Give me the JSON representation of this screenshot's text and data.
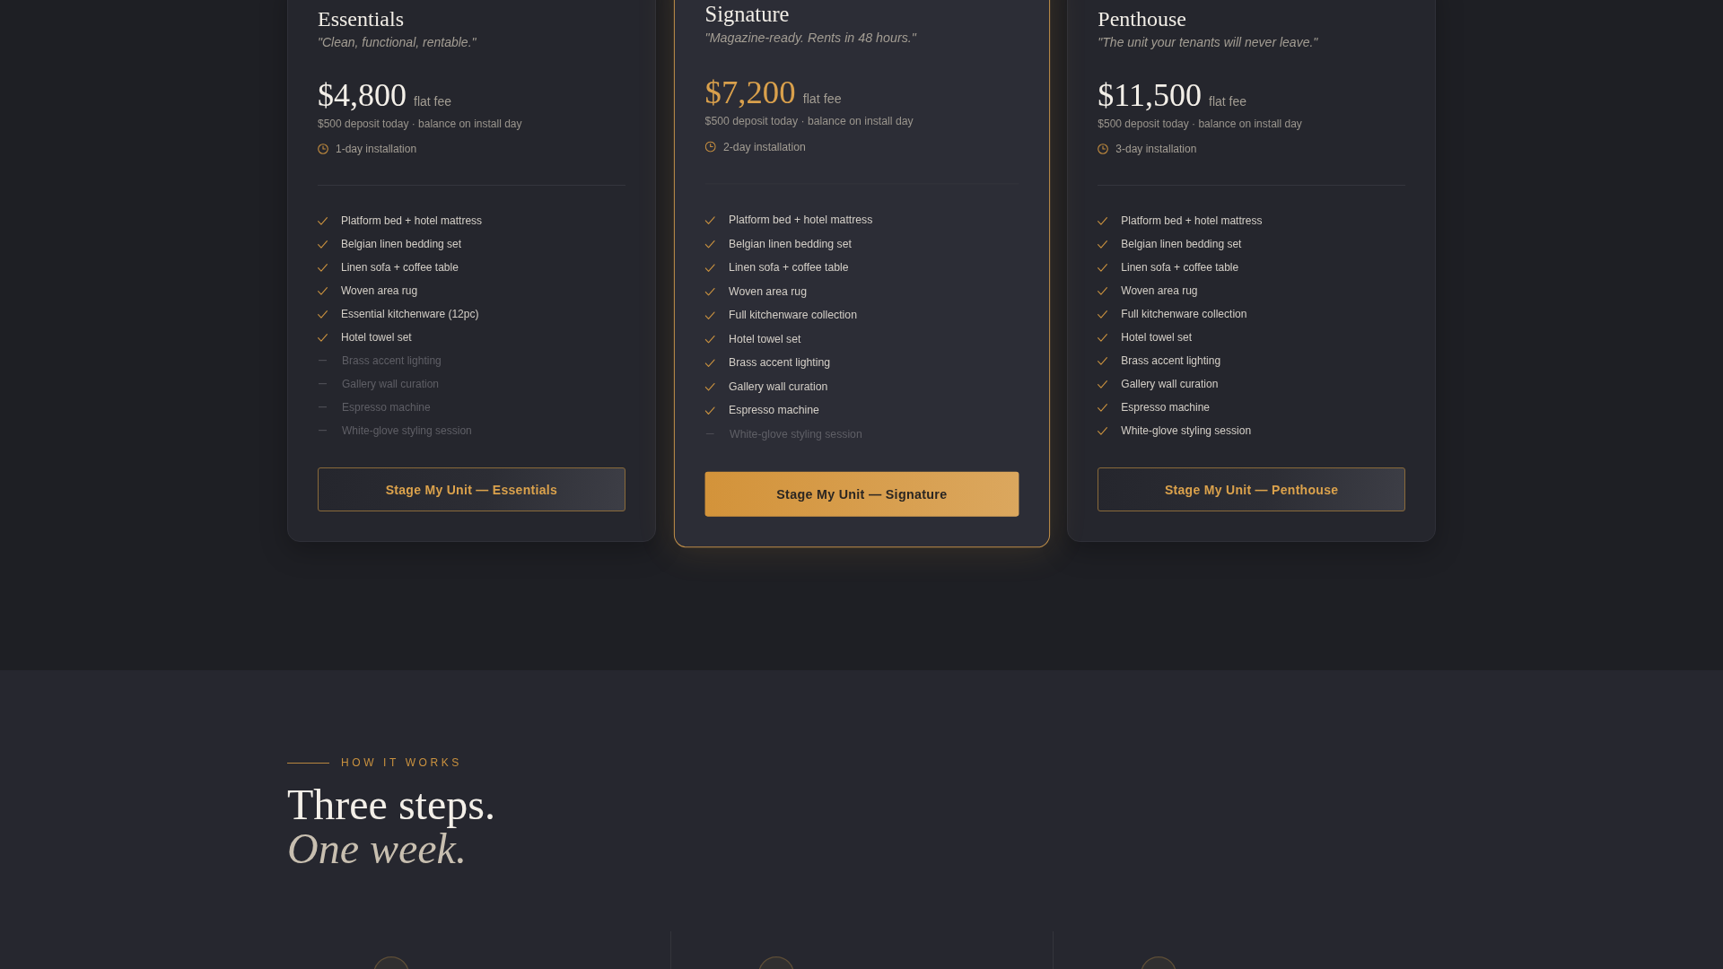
{
  "plans": [
    {
      "name": "Essentials",
      "tagline": "\"Clean, functional, rentable.\"",
      "price": "$4,800",
      "price_unit": "flat fee",
      "payment_note": "$500 deposit today · balance on install day",
      "installation": "1-day installation",
      "featured": false,
      "features": [
        {
          "label": "Platform bed + hotel mattress",
          "included": true
        },
        {
          "label": "Belgian linen bedding set",
          "included": true
        },
        {
          "label": "Linen sofa + coffee table",
          "included": true
        },
        {
          "label": "Woven area rug",
          "included": true
        },
        {
          "label": "Essential kitchenware (12pc)",
          "included": true
        },
        {
          "label": "Hotel towel set",
          "included": true
        },
        {
          "label": "Brass accent lighting",
          "included": false
        },
        {
          "label": "Gallery wall curation",
          "included": false
        },
        {
          "label": "Espresso machine",
          "included": false
        },
        {
          "label": "White-glove styling session",
          "included": false
        }
      ],
      "button": "Stage My Unit — Essentials"
    },
    {
      "name": "Signature",
      "tagline": "\"Magazine-ready. Rents in 48 hours.\"",
      "price": "$7,200",
      "price_unit": "flat fee",
      "payment_note": "$500 deposit today · balance on install day",
      "installation": "2-day installation",
      "featured": true,
      "features": [
        {
          "label": "Platform bed + hotel mattress",
          "included": true
        },
        {
          "label": "Belgian linen bedding set",
          "included": true
        },
        {
          "label": "Linen sofa + coffee table",
          "included": true
        },
        {
          "label": "Woven area rug",
          "included": true
        },
        {
          "label": "Full kitchenware collection",
          "included": true
        },
        {
          "label": "Hotel towel set",
          "included": true
        },
        {
          "label": "Brass accent lighting",
          "included": true
        },
        {
          "label": "Gallery wall curation",
          "included": true
        },
        {
          "label": "Espresso machine",
          "included": true
        },
        {
          "label": "White-glove styling session",
          "included": false
        }
      ],
      "button": "Stage My Unit — Signature"
    },
    {
      "name": "Penthouse",
      "tagline": "\"The unit your tenants will never leave.\"",
      "price": "$11,500",
      "price_unit": "flat fee",
      "payment_note": "$500 deposit today · balance on install day",
      "installation": "3-day installation",
      "featured": false,
      "features": [
        {
          "label": "Platform bed + hotel mattress",
          "included": true
        },
        {
          "label": "Belgian linen bedding set",
          "included": true
        },
        {
          "label": "Linen sofa + coffee table",
          "included": true
        },
        {
          "label": "Woven area rug",
          "included": true
        },
        {
          "label": "Full kitchenware collection",
          "included": true
        },
        {
          "label": "Hotel towel set",
          "included": true
        },
        {
          "label": "Brass accent lighting",
          "included": true
        },
        {
          "label": "Gallery wall curation",
          "included": true
        },
        {
          "label": "Espresso machine",
          "included": true
        },
        {
          "label": "White-glove styling session",
          "included": true
        }
      ],
      "button": "Stage My Unit — Penthouse"
    }
  ],
  "how_it_works": {
    "eyebrow": "HOW IT WORKS",
    "heading": "Three steps. *One week.*"
  }
}
